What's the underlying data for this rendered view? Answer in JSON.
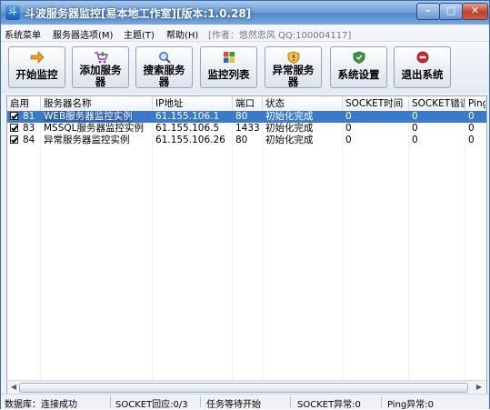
{
  "window": {
    "title": "斗波服务器监控[易本地工作室][版本:1.0.28]",
    "controls": {
      "minimize": "–",
      "maximize": "□",
      "close": "✕"
    }
  },
  "menu": {
    "items": [
      "系统菜单",
      "服务器选项(M)",
      "主题(T)",
      "帮助(H)"
    ],
    "author": "[作者：悠然忠风 QQ:100004117]"
  },
  "toolbar": {
    "buttons": [
      {
        "line1": "开始监控",
        "line2": "",
        "icon": "arrow-right-icon",
        "color": "#f0a020"
      },
      {
        "line1": "添加服务",
        "line2": "器",
        "icon": "cart-add-icon",
        "color": "#9b3bb0"
      },
      {
        "line1": "搜索服务",
        "line2": "器",
        "icon": "magnifier-icon",
        "color": "#3a70c8"
      },
      {
        "line1": "监控列表",
        "line2": "",
        "icon": "windows-flag-icon",
        "color": "#e05020"
      },
      {
        "line1": "异常服务",
        "line2": "器",
        "icon": "warning-shield-icon",
        "color": "#d8a020"
      },
      {
        "line1": "系统设置",
        "line2": "",
        "icon": "settings-shield-icon",
        "color": "#3a9a3a"
      },
      {
        "line1": "退出系统",
        "line2": "",
        "icon": "stop-icon",
        "color": "#d02828"
      }
    ]
  },
  "table": {
    "columns": [
      "启用",
      "服务器名称",
      "IP地址",
      "端口",
      "状态",
      "SOCKET时间",
      "SOCKET错误",
      "Ping"
    ],
    "rows": [
      {
        "enabled": true,
        "id": "81",
        "name": "WEB服务器监控实例",
        "ip": "61.155.106.1",
        "port": "80",
        "status": "初始化完成",
        "socket_time": "0",
        "socket_err": "0",
        "ping": "0",
        "selected": true
      },
      {
        "enabled": true,
        "id": "83",
        "name": "MSSQL服务器监控实例",
        "ip": "61.155.106.5",
        "port": "1433",
        "status": "初始化完成",
        "socket_time": "0",
        "socket_err": "0",
        "ping": "0",
        "selected": false
      },
      {
        "enabled": true,
        "id": "84",
        "name": "异常服务器监控实例",
        "ip": "61.155.106.26",
        "port": "80",
        "status": "初始化完成",
        "socket_time": "0",
        "socket_err": "0",
        "ping": "0",
        "selected": false
      }
    ]
  },
  "statusbar": {
    "db": "数据库：连接成功",
    "socket_reply": "SOCKET回应:0/3",
    "task": "任务等待开始",
    "socket_error": "SOCKET异常:0",
    "ping_error": "Ping异常:0"
  }
}
